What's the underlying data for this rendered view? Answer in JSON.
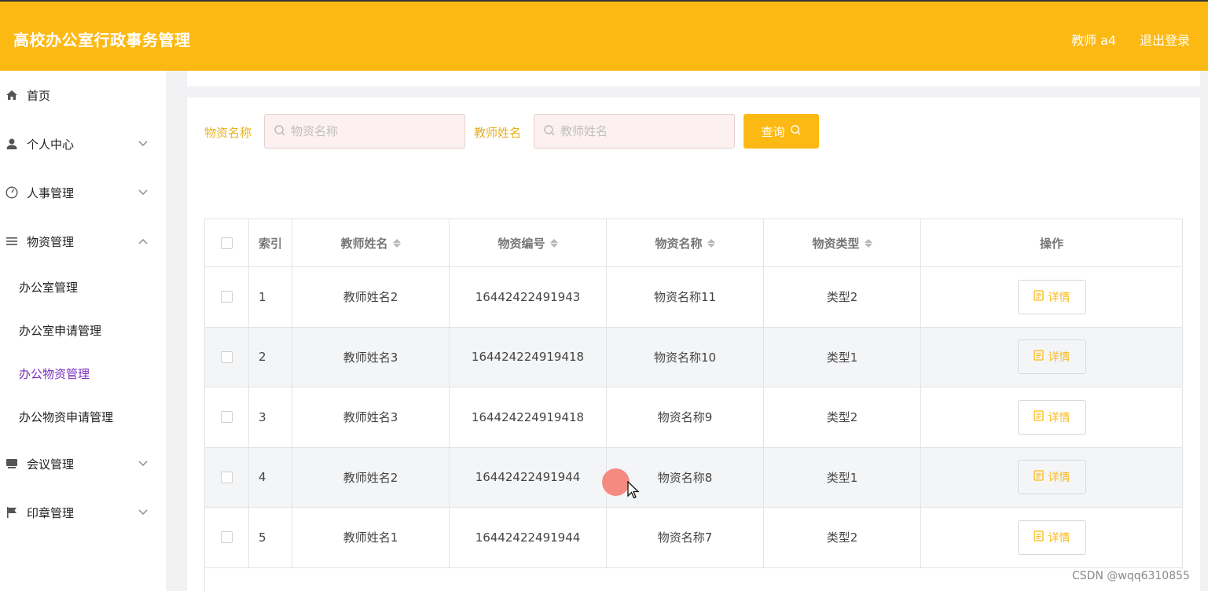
{
  "header": {
    "title": "高校办公室行政事务管理",
    "user": "教师 a4",
    "logout": "退出登录"
  },
  "sidebar": {
    "items": [
      {
        "label": "首页",
        "icon": "home-icon"
      },
      {
        "label": "个人中心",
        "icon": "user-icon"
      },
      {
        "label": "人事管理",
        "icon": "dashboard-icon"
      },
      {
        "label": "物资管理",
        "icon": "list-icon"
      },
      {
        "label": "会议管理",
        "icon": "meeting-icon"
      },
      {
        "label": "印章管理",
        "icon": "flag-icon"
      }
    ],
    "sub_items": [
      "办公室管理",
      "办公室申请管理",
      "办公物资管理",
      "办公物资申请管理"
    ],
    "active_sub": "办公物资管理"
  },
  "search": {
    "label1": "物资名称",
    "placeholder1": "物资名称",
    "label2": "教师姓名",
    "placeholder2": "教师姓名",
    "button": "查询"
  },
  "table": {
    "headers": [
      "索引",
      "教师姓名",
      "物资编号",
      "物资名称",
      "物资类型",
      "操作"
    ],
    "rows": [
      {
        "index": "1",
        "teacher": "教师姓名2",
        "code": "16442422491943",
        "name": "物资名称11",
        "type": "类型2",
        "action": "详情"
      },
      {
        "index": "2",
        "teacher": "教师姓名3",
        "code": "164424224919418",
        "name": "物资名称10",
        "type": "类型1",
        "action": "详情"
      },
      {
        "index": "3",
        "teacher": "教师姓名3",
        "code": "164424224919418",
        "name": "物资名称9",
        "type": "类型2",
        "action": "详情"
      },
      {
        "index": "4",
        "teacher": "教师姓名2",
        "code": "16442422491944",
        "name": "物资名称8",
        "type": "类型1",
        "action": "详情"
      },
      {
        "index": "5",
        "teacher": "教师姓名1",
        "code": "16442422491944",
        "name": "物资名称7",
        "type": "类型2",
        "action": "详情"
      }
    ]
  },
  "watermark": "CSDN @wqq6310855",
  "colors": {
    "accent": "#fdb913",
    "active_menu": "#7b2fbf"
  }
}
